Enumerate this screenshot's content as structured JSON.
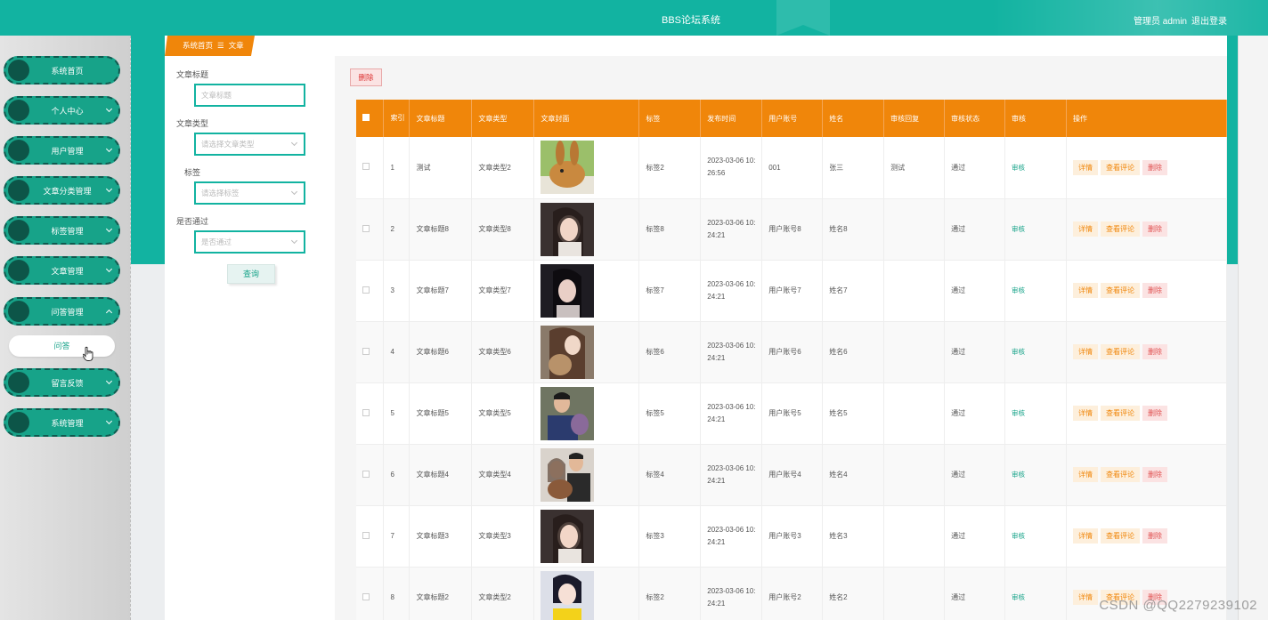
{
  "header": {
    "title": "BBS论坛系统",
    "admin_label": "管理员 admin",
    "logout_label": "退出登录"
  },
  "sidebar": {
    "items": [
      {
        "label": "系统首页",
        "has_chevron": false
      },
      {
        "label": "个人中心",
        "has_chevron": true
      },
      {
        "label": "用户管理",
        "has_chevron": true
      },
      {
        "label": "文章分类管理",
        "has_chevron": true
      },
      {
        "label": "标签管理",
        "has_chevron": true
      },
      {
        "label": "文章管理",
        "has_chevron": true
      },
      {
        "label": "问答管理",
        "has_chevron": true,
        "expanded": true
      },
      {
        "label": "留言反馈",
        "has_chevron": true
      },
      {
        "label": "系统管理",
        "has_chevron": true
      }
    ],
    "submenu": {
      "label": "问答"
    }
  },
  "breadcrumb": {
    "home": "系统首页",
    "separator": "☰",
    "current": "文章"
  },
  "search": {
    "title_label": "文章标题",
    "title_placeholder": "文章标题",
    "type_label": "文章类型",
    "type_placeholder": "请选择文章类型",
    "tag_label": "标签",
    "tag_placeholder": "请选择标签",
    "pass_label": "是否通过",
    "pass_placeholder": "是否通过",
    "query_button": "查询"
  },
  "toolbar": {
    "delete_label": "删除"
  },
  "table": {
    "headers": [
      "索引",
      "文章标题",
      "文章类型",
      "文章封面",
      "标签",
      "发布时间",
      "用户账号",
      "姓名",
      "审核回复",
      "审核状态",
      "审核",
      "操作"
    ],
    "rows": [
      {
        "index": "1",
        "title": "测试",
        "type": "文章类型2",
        "tag": "标签2",
        "time": "2023-03-06 10:26:56",
        "account": "001",
        "name": "张三",
        "reply": "测试",
        "status": "通过",
        "cover": "rabbit"
      },
      {
        "index": "2",
        "title": "文章标题8",
        "type": "文章类型8",
        "tag": "标签8",
        "time": "2023-03-06 10:24:21",
        "account": "用户账号8",
        "name": "姓名8",
        "reply": "",
        "status": "通过",
        "cover": "portrait"
      },
      {
        "index": "3",
        "title": "文章标题7",
        "type": "文章类型7",
        "tag": "标签7",
        "time": "2023-03-06 10:24:21",
        "account": "用户账号7",
        "name": "姓名7",
        "reply": "",
        "status": "通过",
        "cover": "portrait-dark"
      },
      {
        "index": "4",
        "title": "文章标题6",
        "type": "文章类型6",
        "tag": "标签6",
        "time": "2023-03-06 10:24:21",
        "account": "用户账号6",
        "name": "姓名6",
        "reply": "",
        "status": "通过",
        "cover": "portrait-dog"
      },
      {
        "index": "5",
        "title": "文章标题5",
        "type": "文章类型5",
        "tag": "标签5",
        "time": "2023-03-06 10:24:21",
        "account": "用户账号5",
        "name": "姓名5",
        "reply": "",
        "status": "通过",
        "cover": "portrait-man"
      },
      {
        "index": "6",
        "title": "文章标题4",
        "type": "文章类型4",
        "tag": "标签4",
        "time": "2023-03-06 10:24:21",
        "account": "用户账号4",
        "name": "姓名4",
        "reply": "",
        "status": "通过",
        "cover": "portrait-couple"
      },
      {
        "index": "7",
        "title": "文章标题3",
        "type": "文章类型3",
        "tag": "标签3",
        "time": "2023-03-06 10:24:21",
        "account": "用户账号3",
        "name": "姓名3",
        "reply": "",
        "status": "通过",
        "cover": "portrait"
      },
      {
        "index": "8",
        "title": "文章标题2",
        "type": "文章类型2",
        "tag": "标签2",
        "time": "2023-03-06 10:24:21",
        "account": "用户账号2",
        "name": "姓名2",
        "reply": "",
        "status": "通过",
        "cover": "portrait-yellow"
      }
    ],
    "audit_label": "审核",
    "actions": {
      "detail": "详情",
      "comments": "查看评论",
      "delete": "删除"
    }
  },
  "watermark": "CSDN @QQ2279239102",
  "colors": {
    "teal": "#12b3a1",
    "orange": "#f0860a",
    "dark_teal": "#0d5548"
  }
}
